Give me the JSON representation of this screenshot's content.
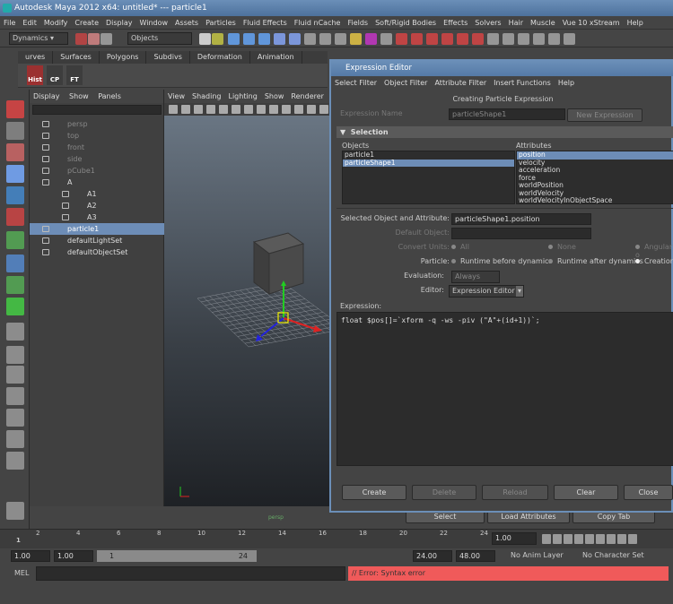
{
  "window": {
    "title": "Autodesk Maya 2012 x64: untitled*   ---   particle1"
  },
  "menubar": [
    "File",
    "Edit",
    "Modify",
    "Create",
    "Display",
    "Window",
    "Assets",
    "Particles",
    "Fluid Effects",
    "Fluid nCache",
    "Fields",
    "Soft/Rigid Bodies",
    "Effects",
    "Solvers",
    "Hair",
    "Muscle",
    "Vue 10 xStream",
    "Help"
  ],
  "status": {
    "menuset": "Dynamics",
    "selection_mode": "Objects"
  },
  "shelf": {
    "tabs": [
      "urves",
      "Surfaces",
      "Polygons",
      "Subdivs",
      "Deformation",
      "Animation",
      "Dynamics",
      "Rendering"
    ],
    "buttons": [
      "Hist",
      "CP",
      "FT"
    ]
  },
  "outliner": {
    "menu": [
      "Display",
      "Show",
      "Panels"
    ],
    "items": [
      {
        "label": "persp",
        "dim": true
      },
      {
        "label": "top",
        "dim": true
      },
      {
        "label": "front",
        "dim": true
      },
      {
        "label": "side",
        "dim": true
      },
      {
        "label": "pCube1",
        "dim": true
      },
      {
        "label": "A"
      },
      {
        "label": "A1"
      },
      {
        "label": "A2"
      },
      {
        "label": "A3"
      },
      {
        "label": "particle1"
      },
      {
        "label": "defaultLightSet"
      },
      {
        "label": "defaultObjectSet"
      }
    ]
  },
  "viewport": {
    "menu": [
      "View",
      "Shading",
      "Lighting",
      "Show",
      "Renderer",
      "Panel"
    ],
    "camera_label": "persp"
  },
  "editor": {
    "title": "Expression Editor",
    "menu": [
      "Select Filter",
      "Object Filter",
      "Attribute Filter",
      "Insert Functions",
      "Help"
    ],
    "heading": "Creating Particle Expression",
    "expression_name_label": "Expression Name",
    "expression_name_value": "particleShape1",
    "new_expression_btn": "New Expression",
    "section": "Selection",
    "objects_label": "Objects",
    "objects": [
      "particle1",
      "particleShape1"
    ],
    "attributes_label": "Attributes",
    "attributes": [
      "position",
      "velocity",
      "acceleration",
      "force",
      "worldPosition",
      "worldVelocity",
      "worldVelocityInObjectSpace"
    ],
    "selected_label": "Selected Object and Attribute:",
    "selected_value": "particleShape1.position",
    "default_object_label": "Default Object:",
    "convert_units_label": "Convert Units:",
    "convert_units_options": [
      "All",
      "None",
      "Angular o"
    ],
    "particle_label": "Particle:",
    "particle_options": [
      "Runtime before dynamics",
      "Runtime after dynamics",
      "Creation"
    ],
    "evaluation_label": "Evaluation:",
    "evaluation_value": "Always",
    "editor_label": "Editor:",
    "editor_value": "Expression Editor",
    "expression_label": "Expression:",
    "expression_text": "float $pos[]=`xform -q -ws -piv (\"A\"+(id+1))`;",
    "buttons": [
      "Create",
      "Delete",
      "Reload",
      "Clear",
      "Close"
    ]
  },
  "attr_buttons": [
    "Select",
    "Load Attributes",
    "Copy Tab"
  ],
  "timeline": {
    "ticks": [
      "1",
      "2",
      "4",
      "6",
      "8",
      "10",
      "12",
      "14",
      "16",
      "18",
      "20",
      "22",
      "24"
    ],
    "current_frame": "1.00"
  },
  "range": {
    "start": "1.00",
    "start2": "1.00",
    "mid_start": "1",
    "mid_end": "24",
    "end1": "24.00",
    "end2": "48.00",
    "anim_layer": "No Anim Layer",
    "character_set": "No Character Set"
  },
  "command": {
    "mel_label": "MEL",
    "result": "// Error: Syntax error"
  },
  "colors": {
    "accent": "#6d8db7",
    "error": "#f05a5a"
  }
}
